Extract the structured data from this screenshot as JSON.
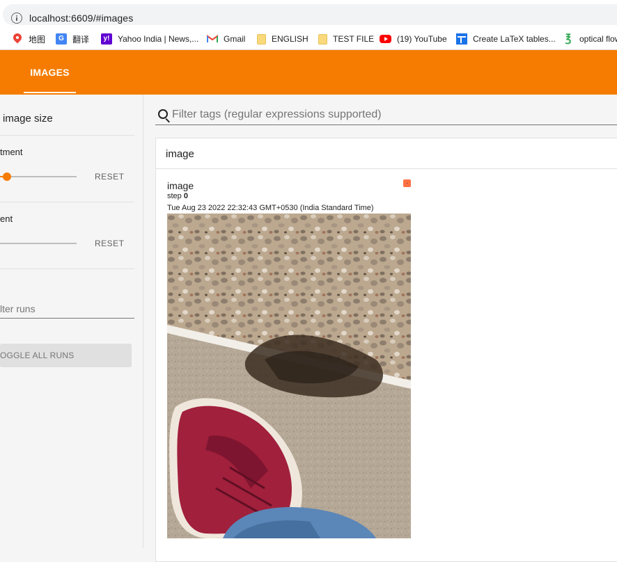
{
  "browser": {
    "url": "localhost:6609/#images",
    "bookmarks": [
      {
        "icon": "maps-icon",
        "label": "地图"
      },
      {
        "icon": "translate-icon",
        "label": "翻译"
      },
      {
        "icon": "yahoo-icon",
        "label": "Yahoo India | News,..."
      },
      {
        "icon": "gmail-icon",
        "label": "Gmail"
      },
      {
        "icon": "folder-icon",
        "label": "ENGLISH"
      },
      {
        "icon": "folder-icon",
        "label": "TEST FILE"
      },
      {
        "icon": "youtube-icon",
        "label": "(19) YouTube"
      },
      {
        "icon": "table-icon",
        "label": "Create LaTeX tables..."
      },
      {
        "icon": "leaf-icon",
        "label": "optical flow"
      }
    ]
  },
  "header": {
    "active_tab": "IMAGES",
    "accent_color": "#f57c00"
  },
  "sidebar": {
    "heading": "image size",
    "brightness": {
      "label": "tment",
      "reset": "RESET",
      "value_fraction": 0.08
    },
    "contrast": {
      "label": "ent",
      "reset": "RESET",
      "value_fraction": 0.0
    },
    "filter_runs_placeholder": "lter runs",
    "toggle_all_label": "OGGLE ALL RUNS"
  },
  "main": {
    "filter_placeholder": "Filter tags (regular expressions supported)",
    "card": {
      "title": "image",
      "tag": "image",
      "step_label": "step",
      "step_value": "0",
      "timestamp": "Tue Aug 23 2022 22:32:43 GMT+0530 (India Standard Time)",
      "run_color": "#ff7043"
    }
  }
}
